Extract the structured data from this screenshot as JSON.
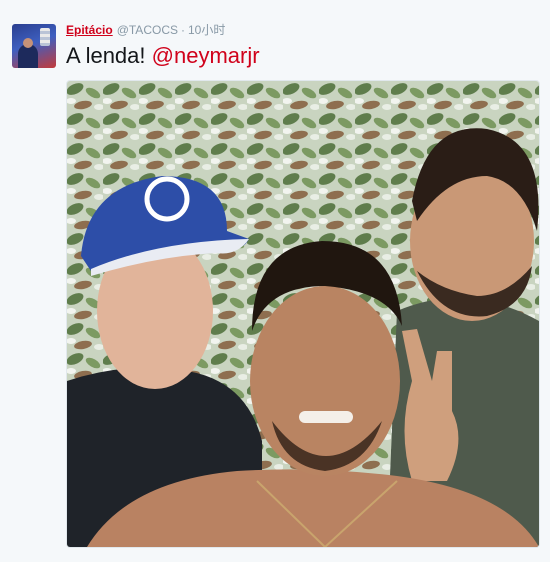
{
  "tweet": {
    "author_name": "Epitácio",
    "handle": "@TACOCS",
    "separator": "·",
    "time": "10小时",
    "text_prefix": "A lenda! ",
    "mention": "@neymarjr"
  },
  "colors": {
    "accent": "#d0021b",
    "muted": "#8899a6",
    "text": "#14171a",
    "background": "#f5f8fa"
  }
}
